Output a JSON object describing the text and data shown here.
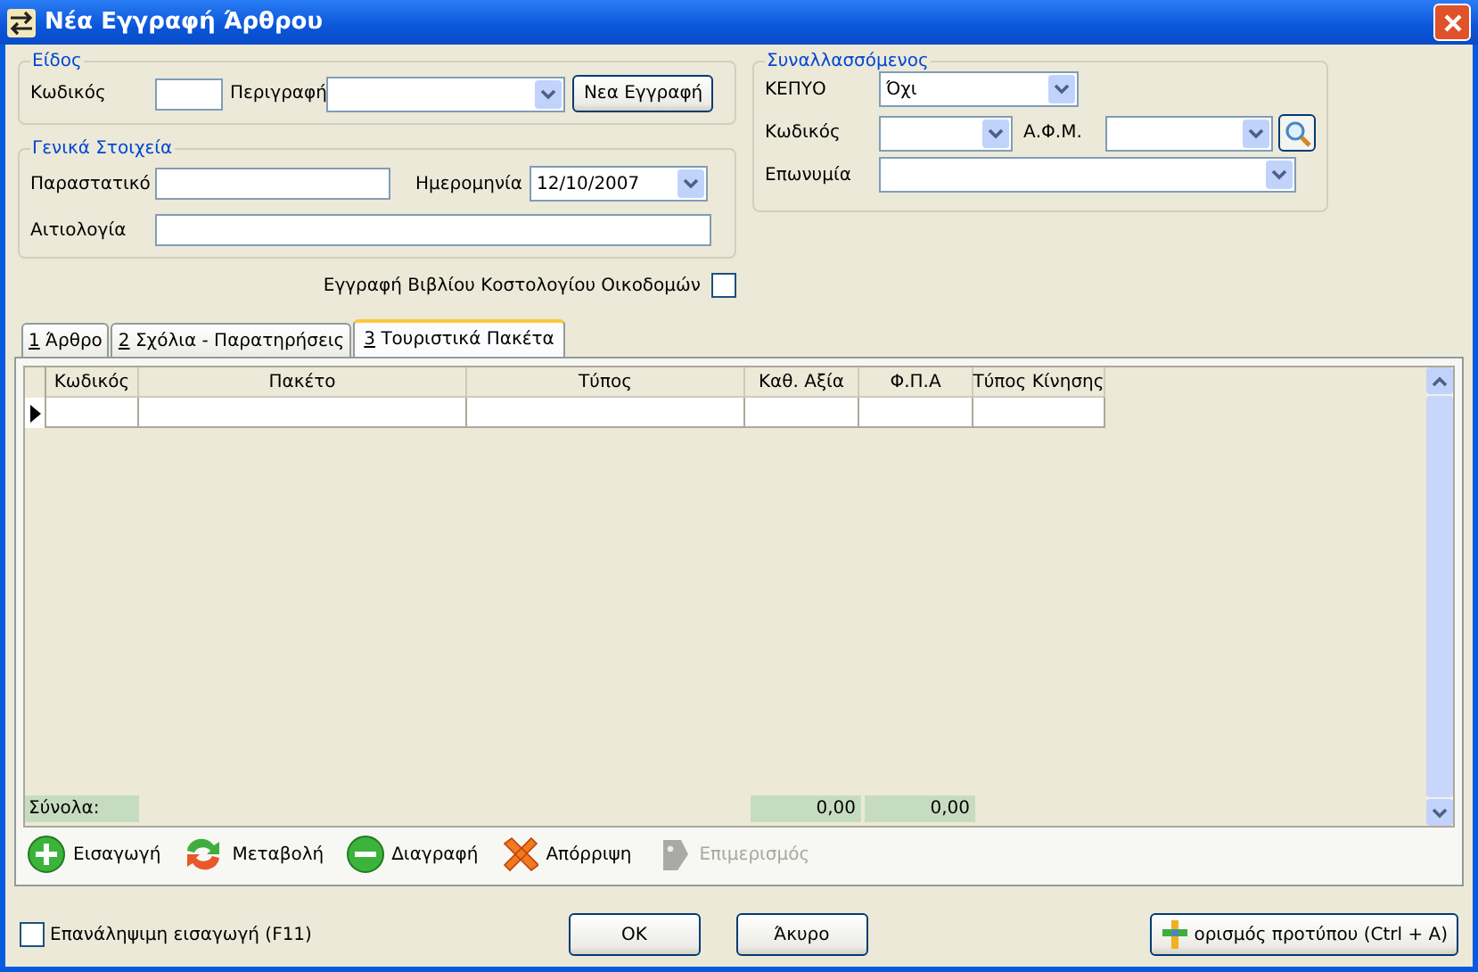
{
  "window": {
    "title": "Νέα Εγγραφή Άρθρου"
  },
  "eidos": {
    "legend": "Είδος",
    "code_label": "Κωδικός",
    "description_label": "Περιγραφή",
    "new_button": "Νεα Εγγραφή"
  },
  "general": {
    "legend": "Γενικά Στοιχεία",
    "document_label": "Παραστατικό",
    "date_label": "Ημερομηνία",
    "date_value": "12/10/2007",
    "reason_label": "Αιτιολογία"
  },
  "counterparty": {
    "legend": "Συναλλασσόμενος",
    "kepyo_label": "ΚΕΠΥΟ",
    "kepyo_value": "Όχι",
    "code_label": "Κωδικός",
    "afm_label": "Α.Φ.Μ.",
    "name_label": "Επωνυμία"
  },
  "construction_book": {
    "label": "Εγγραφή Βιβλίου Κοστολογίου Οικοδομών",
    "checked": false
  },
  "tabs": [
    {
      "hotkey": "1",
      "label": "Άρθρο",
      "selected": false
    },
    {
      "hotkey": "2",
      "label": "Σχόλια - Παρατηρήσεις",
      "selected": false
    },
    {
      "hotkey": "3",
      "label": "Τουριστικά Πακέτα",
      "selected": true
    }
  ],
  "table": {
    "columns": [
      "Κωδικός",
      "Πακέτο",
      "Τύπος",
      "Καθ. Αξία",
      "Φ.Π.Α",
      "Τύπος Κίνησης"
    ],
    "totals_label": "Σύνολα:",
    "value_total": "0,00",
    "vat_total": "0,00"
  },
  "toolbar": [
    {
      "kind": "add",
      "label": "Εισαγωγή",
      "disabled": false
    },
    {
      "kind": "change",
      "label": "Μεταβολή",
      "disabled": false
    },
    {
      "kind": "delete",
      "label": "Διαγραφή",
      "disabled": false
    },
    {
      "kind": "reject",
      "label": "Απόρριψη",
      "disabled": false
    },
    {
      "kind": "allocate",
      "label": "Επιμερισμός",
      "disabled": true
    }
  ],
  "repeat_entry": {
    "label": "Επανάληψιμη εισαγωγή (F11)",
    "checked": false
  },
  "buttons": {
    "ok": "OK",
    "cancel": "Άκυρο",
    "template": "ορισμός προτύπου (Ctrl + A)"
  }
}
